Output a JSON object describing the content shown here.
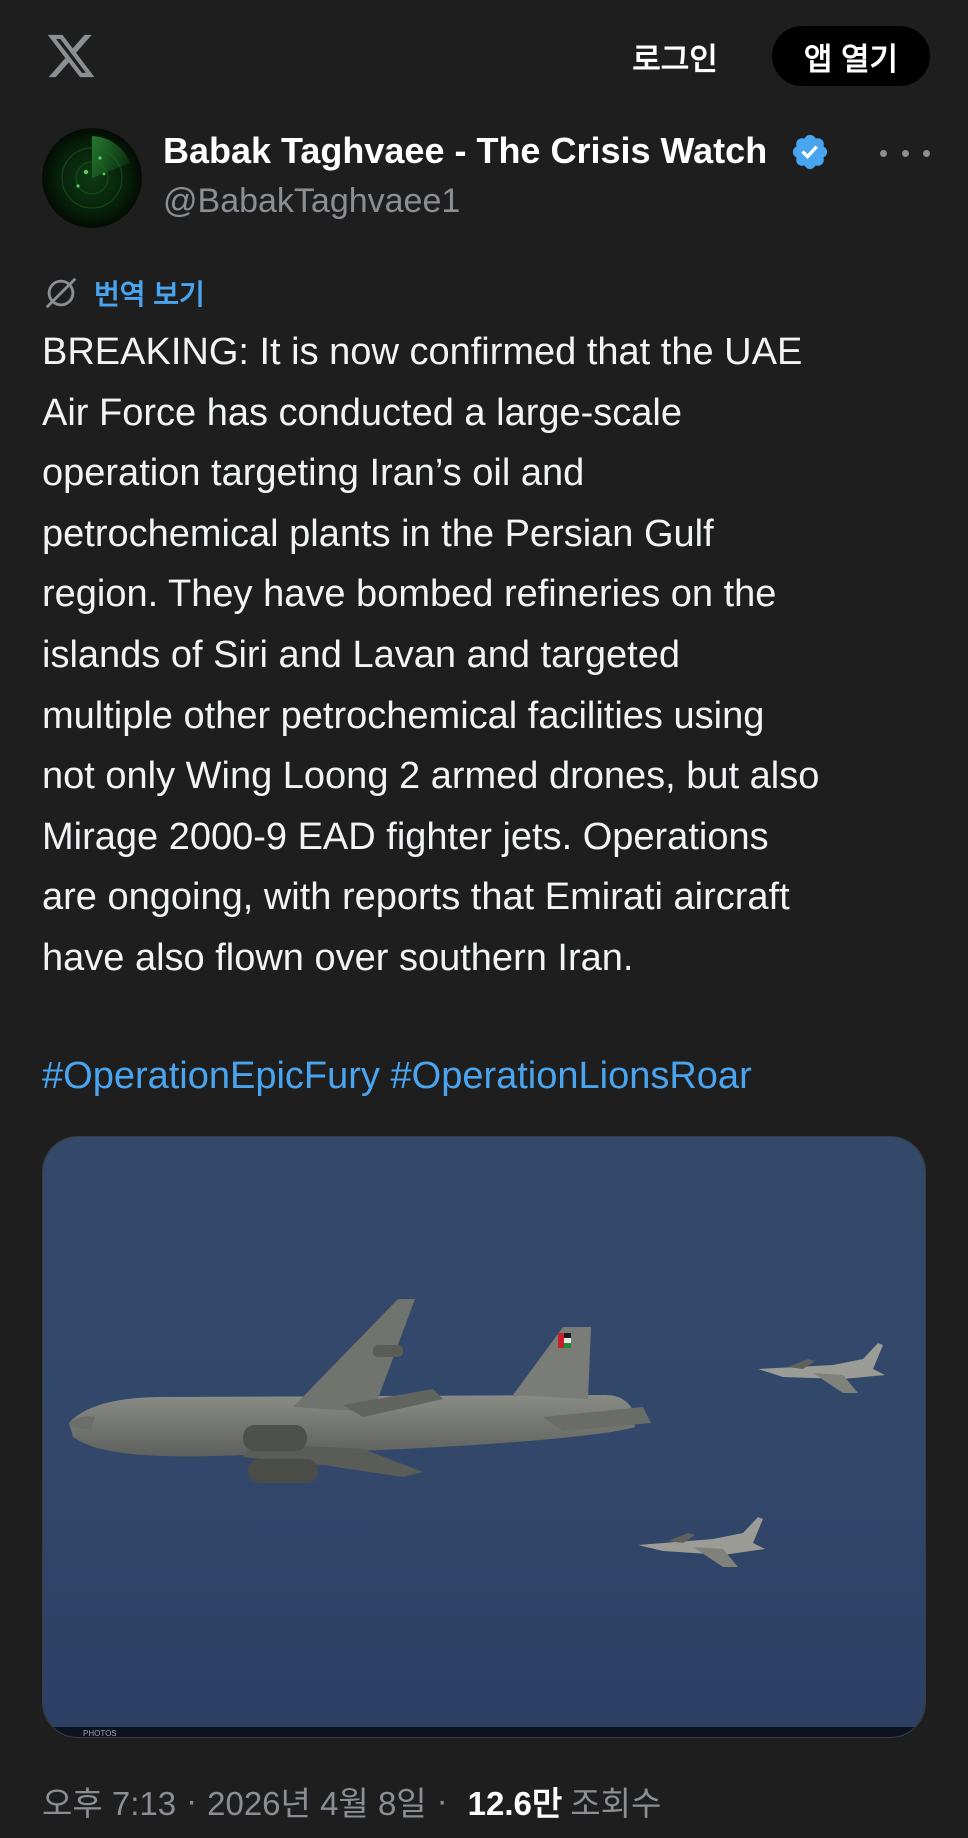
{
  "header": {
    "login_label": "로그인",
    "open_app_label": "앱 열기",
    "logo_icon": "x-logo-icon"
  },
  "author": {
    "name": "Babak Taghvaee - The Crisis Watch",
    "handle": "@BabakTaghvaee1",
    "verified": true,
    "verified_color": "#4aa5f0"
  },
  "translate": {
    "label": "번역 보기",
    "icon": "translate-globe-icon"
  },
  "post": {
    "text": "BREAKING: It is now confirmed that the UAE\nAir Force has conducted a large-scale\noperation targeting Iran’s oil and\npetrochemical plants in the Persian Gulf\nregion. They have bombed refineries on the\nislands of Siri and Lavan and targeted\nmultiple other petrochemical facilities using\nnot only Wing Loong 2 armed drones, but also\nMirage 2000-9 EAD fighter jets. Operations\nare ongoing, with reports that Emirati aircraft\nhave also flown over southern Iran.",
    "hashtags": [
      "#OperationEpicFury",
      "#OperationLionsRoar"
    ]
  },
  "media": {
    "watermark_left": "PHOTOS"
  },
  "meta": {
    "time": "오후 7:13",
    "date": "2026년 4월 8일",
    "separator": "·",
    "views_count": "12.6만",
    "views_label": "조회수"
  },
  "colors": {
    "background": "#1e1e1e",
    "link": "#4aa5f0",
    "muted": "#8b8f94",
    "sky_top": "#34496a",
    "sky_bottom": "#2c3f63"
  }
}
